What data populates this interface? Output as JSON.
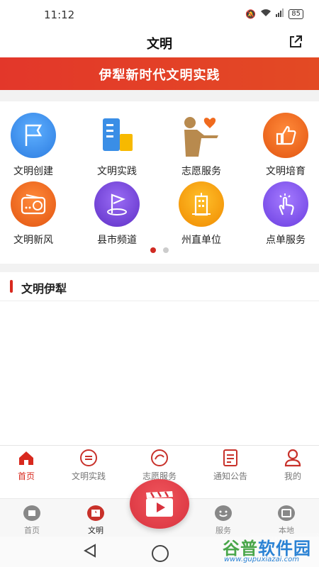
{
  "status_bar": {
    "time": "11:12",
    "battery": "85"
  },
  "header": {
    "title": "文明"
  },
  "banner": {
    "text": "伊犁新时代文明实践"
  },
  "grid": {
    "items": [
      {
        "label": "文明创建",
        "icon": "flag-icon",
        "color": "#3a8ee6"
      },
      {
        "label": "文明实践",
        "icon": "building-icon",
        "color": "#3a8ee6"
      },
      {
        "label": "志愿服务",
        "icon": "volunteer-icon",
        "color": "#b88a4e"
      },
      {
        "label": "文明培育",
        "icon": "thumbs-up-icon",
        "color": "#f06a1e"
      },
      {
        "label": "文明新风",
        "icon": "radio-icon",
        "color": "#f06a1e"
      },
      {
        "label": "县市频道",
        "icon": "map-flag-icon",
        "color": "#7a4bd8"
      },
      {
        "label": "州直单位",
        "icon": "office-building-icon",
        "color": "#f5a000"
      },
      {
        "label": "点单服务",
        "icon": "tap-hand-icon",
        "color": "#8a4bf0"
      }
    ],
    "page_dots": {
      "total": 2,
      "active": 1
    }
  },
  "section": {
    "title": "文明伊犁"
  },
  "inner_tabs": [
    {
      "label": "首页",
      "icon": "home-icon",
      "active": true
    },
    {
      "label": "文明实践",
      "icon": "practice-badge-icon",
      "active": false
    },
    {
      "label": "志愿服务",
      "icon": "volunteer-badge-icon",
      "active": false
    },
    {
      "label": "通知公告",
      "icon": "notice-icon",
      "active": false
    },
    {
      "label": "我的",
      "icon": "person-icon",
      "active": false
    }
  ],
  "outer_tabs": [
    {
      "label": "首页",
      "icon": "home-outline-icon",
      "active": false
    },
    {
      "label": "文明",
      "icon": "civilization-icon",
      "active": true
    },
    {
      "label": "服务",
      "icon": "service-icon",
      "active": false
    },
    {
      "label": "本地",
      "icon": "local-icon",
      "active": false
    }
  ],
  "watermark": {
    "brand_a": "谷普",
    "brand_b": "软件园",
    "url": "www.gupuxiazai.com"
  },
  "colors": {
    "accent": "#d8291e",
    "banner": "#e3372a"
  }
}
